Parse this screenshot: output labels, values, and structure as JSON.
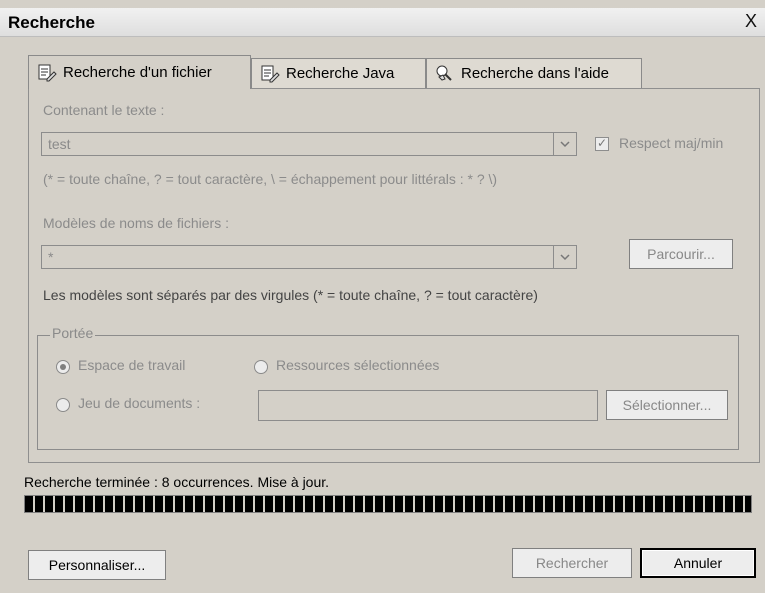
{
  "window": {
    "title": "Recherche",
    "close_glyph": "X"
  },
  "tabs": [
    {
      "label": "Recherche d'un fichier",
      "active": true,
      "icon": "file-search-icon"
    },
    {
      "label": "Recherche Java",
      "active": false,
      "icon": "java-search-icon"
    },
    {
      "label": "Recherche dans l'aide",
      "active": false,
      "icon": "help-search-icon"
    }
  ],
  "search_text": {
    "label": "Contenant le texte :",
    "value": "test",
    "case_sensitive_label": "Respect maj/min",
    "case_sensitive_checked": true,
    "hint": "(* = toute chaîne, ? = tout caractère, \\ = échappement pour littérals : * ? \\)"
  },
  "file_patterns": {
    "label": "Modèles de noms de fichiers :",
    "value": "*",
    "browse_button": "Parcourir...",
    "hint": "Les modèles sont séparés par des virgules (* = toute chaîne, ? = tout caractère)"
  },
  "scope": {
    "group_label": "Portée",
    "workspace_label": "Espace de travail",
    "workspace_selected": true,
    "selected_resources_label": "Ressources sélectionnées",
    "working_set_label": "Jeu de documents :",
    "working_set_value": "",
    "select_button": "Sélectionner..."
  },
  "status": {
    "text": "Recherche terminée : 8 occurrences. Mise à jour.",
    "progress": 1.0
  },
  "footer": {
    "customize_button": "Personnaliser...",
    "search_button": "Rechercher",
    "cancel_button": "Annuler"
  },
  "colors": {
    "dialog_bg": "#d4d0c8",
    "disabled_text": "#8a8a8a",
    "progress_fill": "#000000"
  }
}
